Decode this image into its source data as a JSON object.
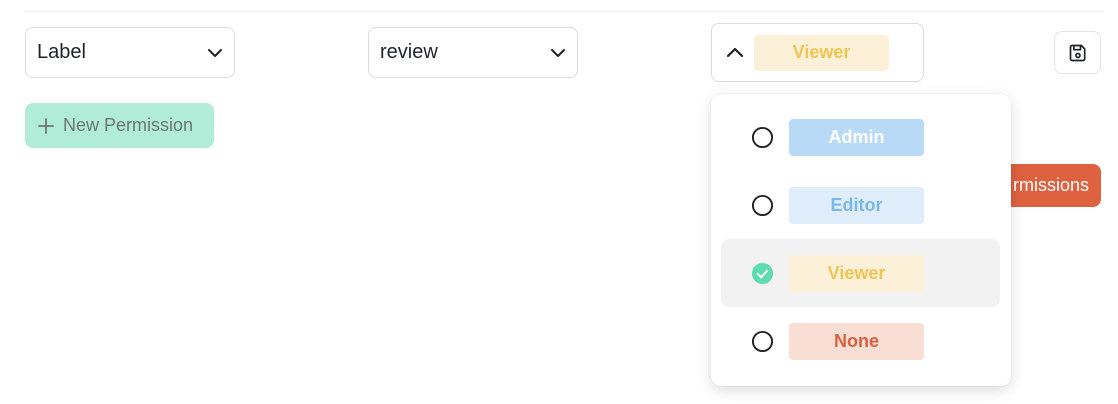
{
  "permission_row": {
    "field_select": {
      "value": "Label",
      "icon": "chevron-down-icon"
    },
    "action_select": {
      "value": "review",
      "icon": "chevron-down-icon"
    },
    "role_select": {
      "value": "Viewer",
      "icon": "chevron-up-icon",
      "expanded": true
    },
    "save_button": {
      "icon": "save-icon"
    }
  },
  "new_permission_button": {
    "label": "New Permission",
    "icon": "plus-icon"
  },
  "permissions_button": {
    "label": "rmissions"
  },
  "role_menu": {
    "items": [
      {
        "label": "Admin",
        "selected": false,
        "color": "#b9daf7",
        "text_color": "#ffffff"
      },
      {
        "label": "Editor",
        "selected": false,
        "color": "#dfedfb",
        "text_color": "#79b8e8"
      },
      {
        "label": "Viewer",
        "selected": true,
        "color": "#fdf0d9",
        "text_color": "#f1c552"
      },
      {
        "label": "None",
        "selected": false,
        "color": "#f9ded4",
        "text_color": "#d8603f"
      }
    ]
  },
  "colors": {
    "accent_green": "#5fdbb0",
    "new_permission_bg": "#b1ecd9",
    "danger": "#de6140"
  }
}
